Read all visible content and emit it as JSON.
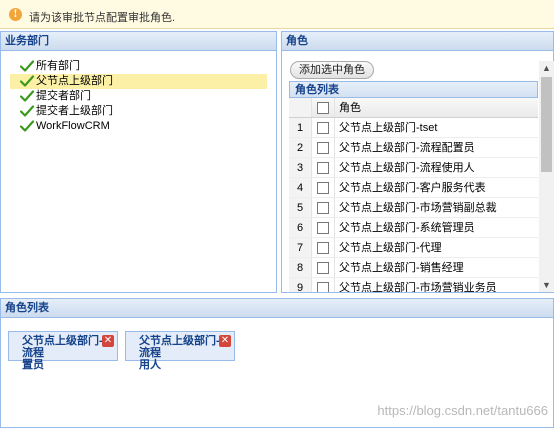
{
  "tip": {
    "message": "请为该审批节点配置审批角色."
  },
  "dept_panel": {
    "title": "业务部门",
    "nodes": [
      "所有部门",
      "父节点上级部门",
      "提交者部门",
      "提交者上级部门",
      "WorkFlowCRM"
    ],
    "selected_index": 1
  },
  "role_panel": {
    "title": "角色",
    "add_button": "添加选中角色",
    "grid_title": "角色列表",
    "column_header": "角色",
    "rows": [
      {
        "num": "1",
        "name": "父节点上级部门-tset"
      },
      {
        "num": "2",
        "name": "父节点上级部门-流程配置员"
      },
      {
        "num": "3",
        "name": "父节点上级部门-流程使用人"
      },
      {
        "num": "4",
        "name": "父节点上级部门-客户服务代表"
      },
      {
        "num": "5",
        "name": "父节点上级部门-市场营销副总裁"
      },
      {
        "num": "6",
        "name": "父节点上级部门-系统管理员"
      },
      {
        "num": "7",
        "name": "父节点上级部门-代理"
      },
      {
        "num": "8",
        "name": "父节点上级部门-销售经理"
      },
      {
        "num": "9",
        "name": "父节点上级部门-市场营销业务员"
      }
    ]
  },
  "role_list_panel": {
    "title": "角色列表",
    "chips": [
      {
        "line1": "父节点上级部门-流程",
        "line2": "置员"
      },
      {
        "line1": "父节点上级部门-流程",
        "line2": "用人"
      }
    ]
  },
  "watermark": "https://blog.csdn.net/tantu666",
  "colors": {
    "accent": "#15428b",
    "border": "#99bbe8",
    "check": "#3a9a1a",
    "selection": "#fbf0a5"
  },
  "icons": {
    "tip": "info-icon",
    "node": "checkmark-icon",
    "remove": "close-icon"
  }
}
